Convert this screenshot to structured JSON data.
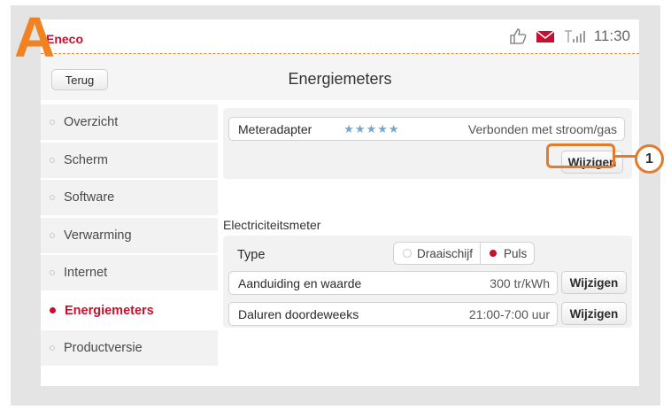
{
  "brand": {
    "logo_text": "Eneco",
    "accent": "#c8102e",
    "annotation_color": "#e37b2a"
  },
  "status": {
    "time": "11:30",
    "icons": [
      "thumbs-up-icon",
      "mail-icon",
      "signal-icon"
    ]
  },
  "header": {
    "back_label": "Terug",
    "title": "Energiemeters"
  },
  "sidebar": {
    "items": [
      {
        "label": "Overzicht",
        "active": false
      },
      {
        "label": "Scherm",
        "active": false
      },
      {
        "label": "Software",
        "active": false
      },
      {
        "label": "Verwarming",
        "active": false
      },
      {
        "label": "Internet",
        "active": false
      },
      {
        "label": "Energiemeters",
        "active": true
      },
      {
        "label": "Productversie",
        "active": false
      }
    ]
  },
  "meteradapter": {
    "label": "Meteradapter",
    "stars": "★★★★★",
    "status": "Verbonden met stroom/gas",
    "change_label": "Wijzigen"
  },
  "electricity": {
    "section_title": "Electriciteitsmeter",
    "type_label": "Type",
    "type_options": [
      {
        "label": "Draaischijf",
        "selected": false
      },
      {
        "label": "Puls",
        "selected": true
      }
    ],
    "rows": [
      {
        "label": "Aanduiding en waarde",
        "value": "300 tr/kWh",
        "button": "Wijzigen"
      },
      {
        "label": "Daluren doordeweeks",
        "value": "21:00-7:00 uur",
        "button": "Wijzigen"
      }
    ]
  },
  "annotations": {
    "corner_letter": "A",
    "callout_number": "1"
  }
}
